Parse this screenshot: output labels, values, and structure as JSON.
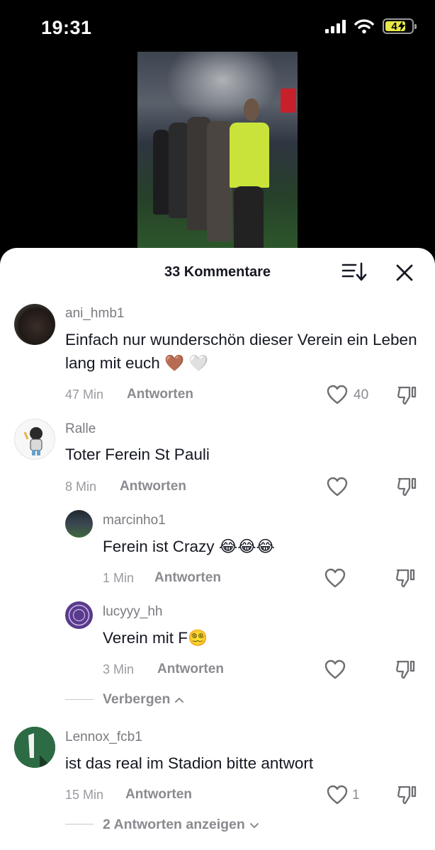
{
  "status": {
    "time": "19:31",
    "battery_text": "4"
  },
  "header": {
    "title": "33 Kommentare"
  },
  "comments": [
    {
      "username": "ani_hmb1",
      "text": "Einfach nur wunderschön dieser Verein ein Leben lang mit euch 🤎 🤍",
      "time": "47 Min",
      "reply_label": "Antworten",
      "likes": "40"
    },
    {
      "username": "Ralle",
      "text": "Toter Ferein St Pauli",
      "time": "8 Min",
      "reply_label": "Antworten",
      "likes": "",
      "replies": [
        {
          "username": "marcinho1",
          "text": "Ferein ist Crazy 😂😂😂",
          "time": "1 Min",
          "reply_label": "Antworten",
          "likes": ""
        },
        {
          "username": "lucyyy_hh",
          "text": "Verein mit F😵‍💫",
          "time": "3 Min",
          "reply_label": "Antworten",
          "likes": ""
        }
      ],
      "toggle_label": "Verbergen"
    },
    {
      "username": "Lennox_fcb1",
      "text": "ist das real im Stadion bitte antwort",
      "time": "15 Min",
      "reply_label": "Antworten",
      "likes": "1",
      "toggle_label": "2 Antworten anzeigen"
    }
  ],
  "colors": {
    "sheet_bg": "#ffffff",
    "text": "#161823",
    "muted": "#8a8a90",
    "vest": "#c9e33a"
  }
}
